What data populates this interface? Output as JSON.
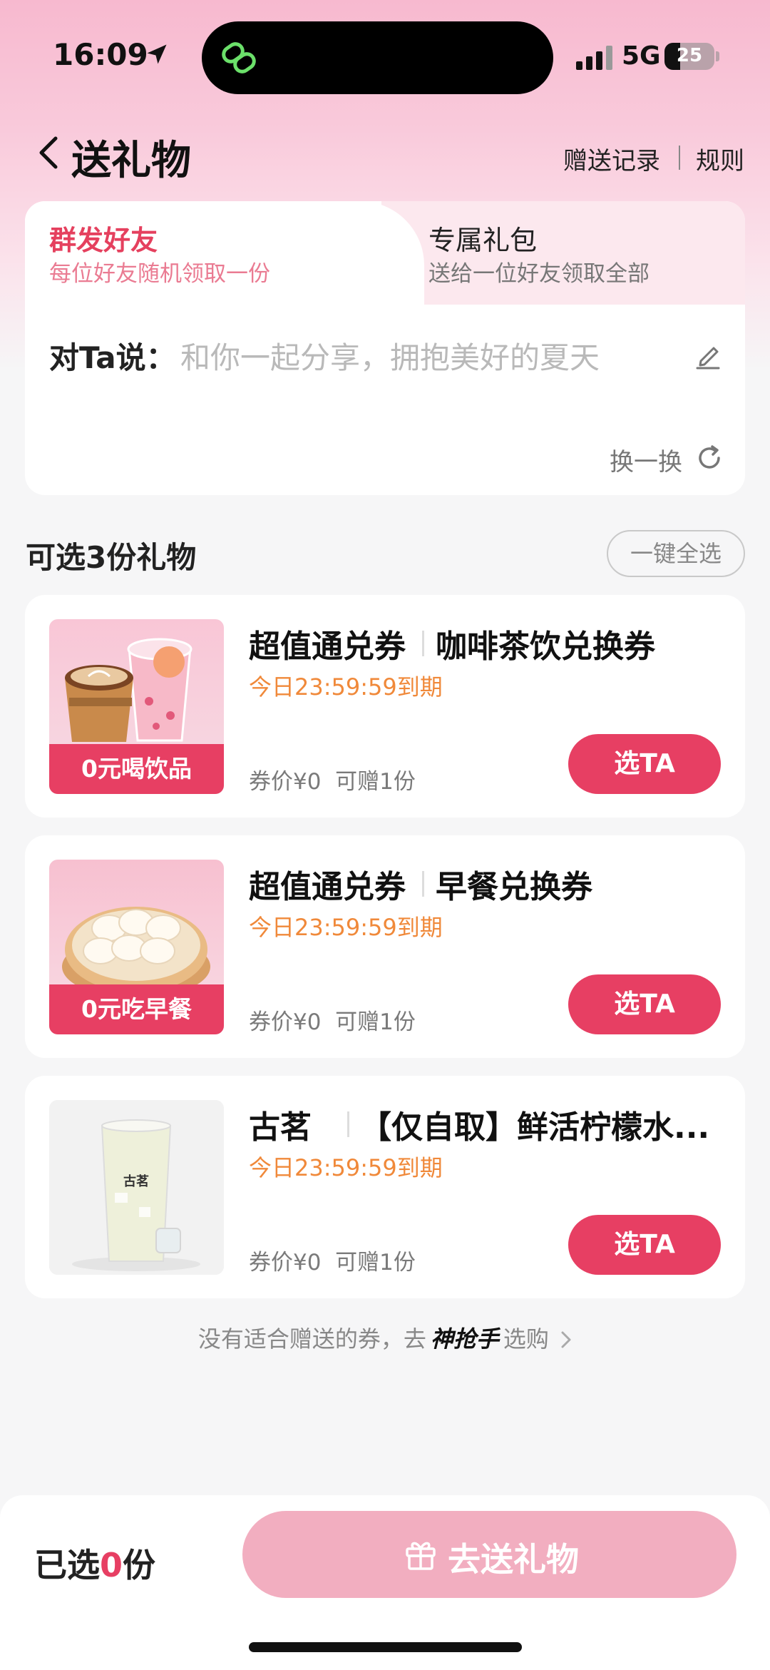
{
  "status_bar": {
    "time": "16:09",
    "network": "5G",
    "battery": "25"
  },
  "header": {
    "title": "送礼物",
    "records_link": "赠送记录",
    "rules_link": "规则"
  },
  "mode_tabs": [
    {
      "title": "群发好友",
      "subtitle": "每位好友随机领取一份",
      "active": true
    },
    {
      "title": "专属礼包",
      "subtitle": "送给一位好友领取全部",
      "active": false
    }
  ],
  "message": {
    "label": "对Ta说：",
    "text": "和你一起分享，拥抱美好的夏天",
    "refresh_label": "换一换"
  },
  "section": {
    "title": "可选3份礼物",
    "select_all": "一键全选"
  },
  "gifts": [
    {
      "thumb_label": "0元喝饮品",
      "brand": "超值通兑券",
      "name": "咖啡茶饮兑换券",
      "expiry": "今日23:59:59到期",
      "price": "券价¥0",
      "quota": "可赠1份",
      "button": "选TA"
    },
    {
      "thumb_label": "0元吃早餐",
      "brand": "超值通兑券",
      "name": "早餐兑换券",
      "expiry": "今日23:59:59到期",
      "price": "券价¥0",
      "quota": "可赠1份",
      "button": "选TA"
    },
    {
      "thumb_label": "古茗",
      "brand": "古茗",
      "name": "【仅自取】鲜活柠檬水...",
      "expiry": "今日23:59:59到期",
      "price": "券价¥0",
      "quota": "可赠1份",
      "button": "选TA"
    }
  ],
  "footer": {
    "prefix": "没有适合赠送的券，去",
    "brand": "神抢手",
    "suffix": "选购"
  },
  "bottom_bar": {
    "selected_prefix": "已选",
    "selected_count": "0",
    "selected_suffix": "份",
    "send_button": "去送礼物"
  },
  "colors": {
    "accent": "#e73f63",
    "expiry": "#f0893a",
    "send_disabled": "#f2aec0"
  }
}
